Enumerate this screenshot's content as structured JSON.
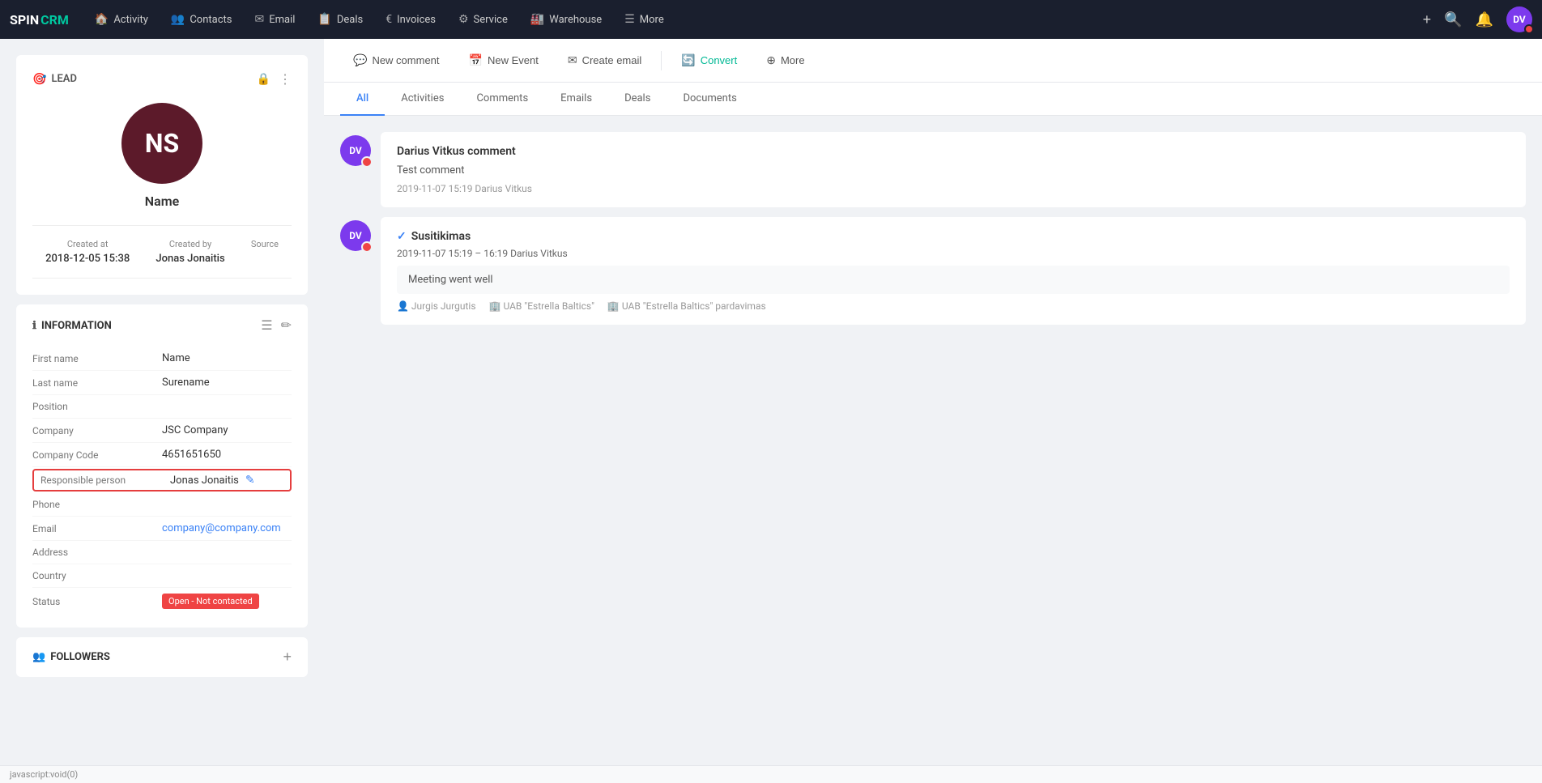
{
  "app": {
    "logo_spin": "SPIN",
    "logo_crm": "CRM"
  },
  "nav": {
    "links": [
      {
        "id": "activity",
        "label": "Activity",
        "icon": "🏠"
      },
      {
        "id": "contacts",
        "label": "Contacts",
        "icon": "👥"
      },
      {
        "id": "email",
        "label": "Email",
        "icon": "✉"
      },
      {
        "id": "deals",
        "label": "Deals",
        "icon": "📋"
      },
      {
        "id": "invoices",
        "label": "Invoices",
        "icon": "€"
      },
      {
        "id": "service",
        "label": "Service",
        "icon": "⚙"
      },
      {
        "id": "warehouse",
        "label": "Warehouse",
        "icon": "🏭"
      },
      {
        "id": "more",
        "label": "More",
        "icon": "☰"
      }
    ],
    "avatar_initials": "DV",
    "avatar_badge": true
  },
  "action_bar": {
    "new_comment_label": "New comment",
    "new_event_label": "New Event",
    "create_email_label": "Create email",
    "convert_label": "Convert",
    "more_label": "More"
  },
  "tabs": [
    {
      "id": "all",
      "label": "All",
      "active": true
    },
    {
      "id": "activities",
      "label": "Activities",
      "active": false
    },
    {
      "id": "comments",
      "label": "Comments",
      "active": false
    },
    {
      "id": "emails",
      "label": "Emails",
      "active": false
    },
    {
      "id": "deals",
      "label": "Deals",
      "active": false
    },
    {
      "id": "documents",
      "label": "Documents",
      "active": false
    }
  ],
  "lead": {
    "badge": "LEAD",
    "avatar_initials": "NS",
    "name": "Name",
    "created_at_label": "Created at",
    "created_at": "2018-12-05 15:38",
    "created_by_label": "Created by",
    "created_by": "Jonas Jonaitis",
    "source_label": "Source"
  },
  "information": {
    "title": "INFORMATION",
    "fields": [
      {
        "label": "First name",
        "value": "Name",
        "key": "first_name"
      },
      {
        "label": "Last name",
        "value": "Surename",
        "key": "last_name"
      },
      {
        "label": "Position",
        "value": "",
        "key": "position"
      },
      {
        "label": "Company",
        "value": "JSC Company",
        "key": "company"
      },
      {
        "label": "Company Code",
        "value": "4651651650",
        "key": "company_code"
      },
      {
        "label": "Responsible person",
        "value": "Jonas Jonaitis",
        "key": "responsible",
        "highlighted": true,
        "has_edit_icon": true
      },
      {
        "label": "Phone",
        "value": "",
        "key": "phone"
      },
      {
        "label": "Email",
        "value": "company@company.com",
        "key": "email",
        "is_link": true
      },
      {
        "label": "Address",
        "value": "",
        "key": "address"
      },
      {
        "label": "Country",
        "value": "",
        "key": "country"
      },
      {
        "label": "Status",
        "value": "Open - Not contacted",
        "key": "status",
        "is_badge": true
      }
    ]
  },
  "followers": {
    "title": "FOLLOWERS"
  },
  "activities": [
    {
      "id": "comment-1",
      "type": "comment",
      "avatar_initials": "DV",
      "avatar_color": "#7c3aed",
      "title": "Darius Vitkus comment",
      "body": "Test comment",
      "date": "2019-11-07 15:19",
      "author": "Darius Vitkus"
    },
    {
      "id": "meeting-1",
      "type": "meeting",
      "avatar_initials": "DV",
      "avatar_color": "#7c3aed",
      "title": "Susitikimas",
      "date": "2019-11-07",
      "time": "15:19 – 16:19",
      "author": "Darius Vitkus",
      "note": "Meeting went well",
      "meta": [
        {
          "icon": "👤",
          "text": "Jurgis Jurgutis"
        },
        {
          "icon": "🏢",
          "text": "UAB \"Estrella Baltics\""
        },
        {
          "icon": "🏢",
          "text": "UAB \"Estrella Baltics\" pardavimas"
        }
      ]
    }
  ],
  "bottombar": {
    "url": "javascript:void(0)"
  }
}
